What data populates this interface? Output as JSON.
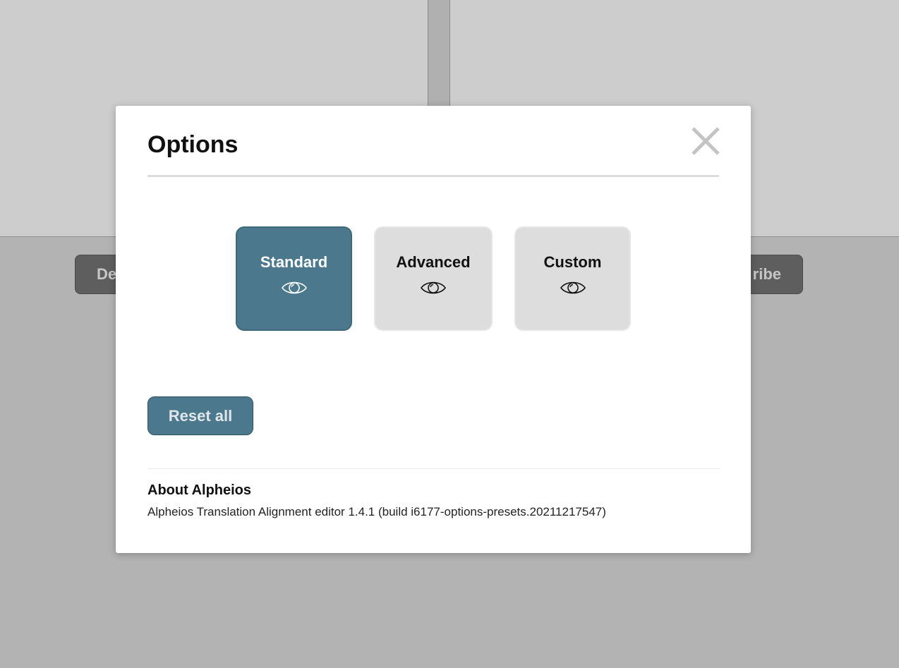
{
  "background": {
    "left_button_label": "De",
    "right_button_label": "ribe"
  },
  "modal": {
    "title": "Options",
    "close_icon": "close-icon",
    "presets": [
      {
        "label": "Standard",
        "icon": "eye-icon",
        "active": true
      },
      {
        "label": "Advanced",
        "icon": "eye-icon",
        "active": false
      },
      {
        "label": "Custom",
        "icon": "eye-icon",
        "active": false
      }
    ],
    "reset_label": "Reset all",
    "about": {
      "title": "About Alpheios",
      "text": "Alpheios Translation Alignment editor 1.4.1 (build i6177-options-presets.20211217547)"
    }
  },
  "colors": {
    "accent": "#4b788c",
    "preset_inactive": "#dddddd",
    "overlay": "#b3b3b3"
  }
}
